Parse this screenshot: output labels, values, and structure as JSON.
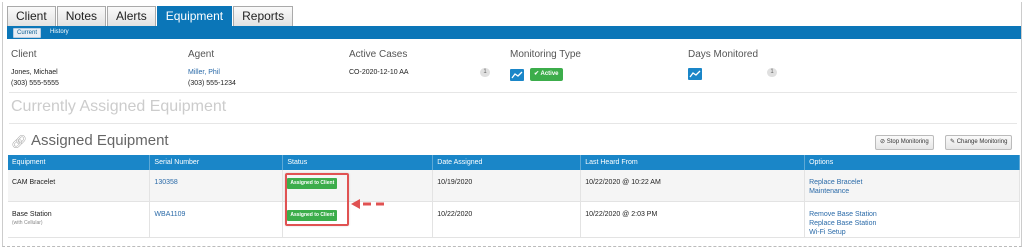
{
  "tabs": [
    {
      "label": "Client"
    },
    {
      "label": "Notes"
    },
    {
      "label": "Alerts"
    },
    {
      "label": "Equipment"
    },
    {
      "label": "Reports"
    }
  ],
  "subtabs": {
    "current": "Current",
    "history": "History"
  },
  "summary": {
    "client": {
      "label": "Client",
      "name": "Jones, Michael",
      "phone": "(303) 555-5555"
    },
    "agent": {
      "label": "Agent",
      "name": "Miller, Phil",
      "phone": "(303) 555-1234"
    },
    "active_cases": {
      "label": "Active Cases",
      "value": "CO-2020-12-10 AA",
      "count": "1"
    },
    "monitoring_type": {
      "label": "Monitoring Type",
      "status": "Active"
    },
    "days_monitored": {
      "label": "Days Monitored",
      "count": "1"
    }
  },
  "big_title": "Currently Assigned Equipment",
  "section_title": "Assigned Equipment",
  "buttons": {
    "stop": "Stop Monitoring",
    "change": "Change Monitoring"
  },
  "table": {
    "headers": [
      "Equipment",
      "Serial Number",
      "Status",
      "Date Assigned",
      "Last Heard From",
      "Options"
    ],
    "rows": [
      {
        "equipment": "CAM Bracelet",
        "equipment_sub": "",
        "serial": "130358",
        "status": "Assigned to Client",
        "date": "10/19/2020",
        "last": "10/22/2020 @ 10:22 AM",
        "options": [
          "Replace Bracelet",
          "Maintenance"
        ]
      },
      {
        "equipment": "Base Station",
        "equipment_sub": "(with Cellular)",
        "serial": "WBA1109",
        "status": "Assigned to Client",
        "date": "10/22/2020",
        "last": "10/22/2020 @ 2:03 PM",
        "options": [
          "Remove Base Station",
          "Replace Base Station",
          "Wi-Fi Setup"
        ]
      }
    ]
  },
  "colors": {
    "accent": "#0b76b8",
    "header": "#1a86c8",
    "status_green": "#3cad4b",
    "annotation": "#e05252"
  },
  "icons": {
    "section": "link-icon",
    "monitoring": "chart-line-icon",
    "stop": "stop-icon",
    "change": "edit-icon"
  }
}
